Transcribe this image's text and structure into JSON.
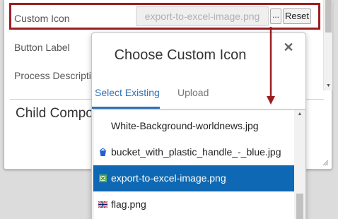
{
  "properties": {
    "custom_icon_label": "Custom Icon",
    "custom_icon_value": "export-to-excel-image.png",
    "browse_button_label": "...",
    "reset_button_label": "Reset",
    "button_label_label": "Button Label",
    "process_description_label": "Process Descripti",
    "child_components_heading": "Child Compo"
  },
  "dialog": {
    "title": "Choose Custom Icon",
    "close_glyph": "✕",
    "tabs": [
      {
        "label": "Select Existing",
        "active": true
      },
      {
        "label": "Upload",
        "active": false
      }
    ],
    "icons": [
      {
        "label": "White-Background-worldnews.jpg",
        "thumb": "none",
        "selected": false
      },
      {
        "label": "bucket_with_plastic_handle_-_blue.jpg",
        "thumb": "blue-bucket-icon",
        "selected": false
      },
      {
        "label": "export-to-excel-image.png",
        "thumb": "excel-export-icon",
        "selected": true
      },
      {
        "label": "flag.png",
        "thumb": "flag-icon",
        "selected": false
      }
    ]
  },
  "colors": {
    "highlight_border": "#9b1d21",
    "arrow": "#9b1d21",
    "tab_active": "#2f72b8",
    "selected_row": "#0f68b3"
  }
}
